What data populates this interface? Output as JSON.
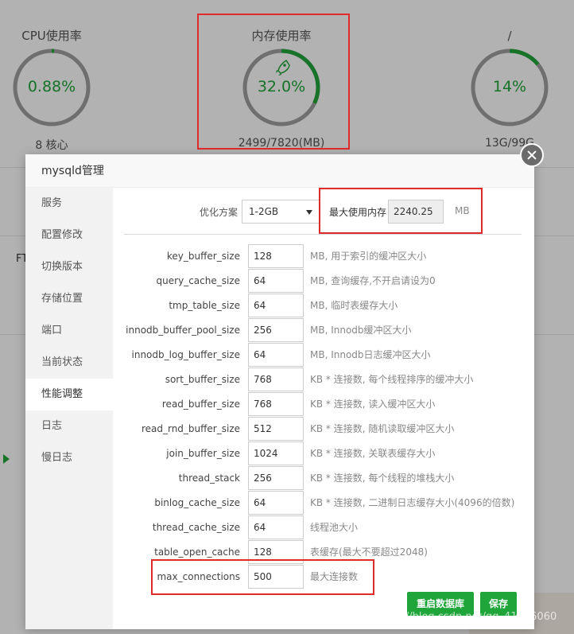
{
  "dashboard": {
    "gauges": [
      {
        "title": "CPU使用率",
        "value": "0.88%",
        "footer": "8 核心",
        "fraction": 0.0088
      },
      {
        "title": "内存使用率",
        "value": "32.0%",
        "footer": "2499/7820(MB)",
        "fraction": 0.32,
        "icon": "rocket-icon"
      },
      {
        "title": "/",
        "value": "14%",
        "footer": "13G/99G",
        "fraction": 0.14
      }
    ],
    "partial_text": "FT"
  },
  "modal": {
    "title": "mysqld管理",
    "sidebar": [
      {
        "label": "服务"
      },
      {
        "label": "配置修改"
      },
      {
        "label": "切换版本"
      },
      {
        "label": "存储位置"
      },
      {
        "label": "端口"
      },
      {
        "label": "当前状态"
      },
      {
        "label": "性能调整",
        "active": true
      },
      {
        "label": "日志"
      },
      {
        "label": "慢日志"
      }
    ],
    "optimize": {
      "label": "优化方案",
      "selected": "1-2GB",
      "max_mem_label": "最大使用内存",
      "max_mem_value": "2240.25",
      "max_mem_unit": "MB"
    },
    "params": [
      {
        "name": "key_buffer_size",
        "value": "128",
        "desc": "MB, 用于索引的缓冲区大小"
      },
      {
        "name": "query_cache_size",
        "value": "64",
        "desc": "MB, 查询缓存,不开启请设为0"
      },
      {
        "name": "tmp_table_size",
        "value": "64",
        "desc": "MB, 临时表缓存大小"
      },
      {
        "name": "innodb_buffer_pool_size",
        "value": "256",
        "desc": "MB, Innodb缓冲区大小"
      },
      {
        "name": "innodb_log_buffer_size",
        "value": "64",
        "desc": "MB, Innodb日志缓冲区大小"
      },
      {
        "name": "sort_buffer_size",
        "value": "768",
        "desc": "KB * 连接数, 每个线程排序的缓冲大小"
      },
      {
        "name": "read_buffer_size",
        "value": "768",
        "desc": "KB * 连接数, 读入缓冲区大小"
      },
      {
        "name": "read_rnd_buffer_size",
        "value": "512",
        "desc": "KB * 连接数, 随机读取缓冲区大小"
      },
      {
        "name": "join_buffer_size",
        "value": "1024",
        "desc": "KB * 连接数, 关联表缓存大小"
      },
      {
        "name": "thread_stack",
        "value": "256",
        "desc": "KB * 连接数, 每个线程的堆栈大小"
      },
      {
        "name": "binlog_cache_size",
        "value": "64",
        "desc": "KB * 连接数, 二进制日志缓存大小(4096的倍数)"
      },
      {
        "name": "thread_cache_size",
        "value": "64",
        "desc": "线程池大小"
      },
      {
        "name": "table_open_cache",
        "value": "128",
        "desc": "表缓存(最大不要超过2048)"
      },
      {
        "name": "max_connections",
        "value": "500",
        "desc": "最大连接数"
      }
    ],
    "buttons": {
      "restart": "重启数据库",
      "save": "保存"
    }
  },
  "watermark": "https://blog.csdn.net/qq_41376060",
  "colors": {
    "accent": "#20a53a",
    "highlight": "#e02b2b",
    "ring_track": "#a0a0a0"
  }
}
